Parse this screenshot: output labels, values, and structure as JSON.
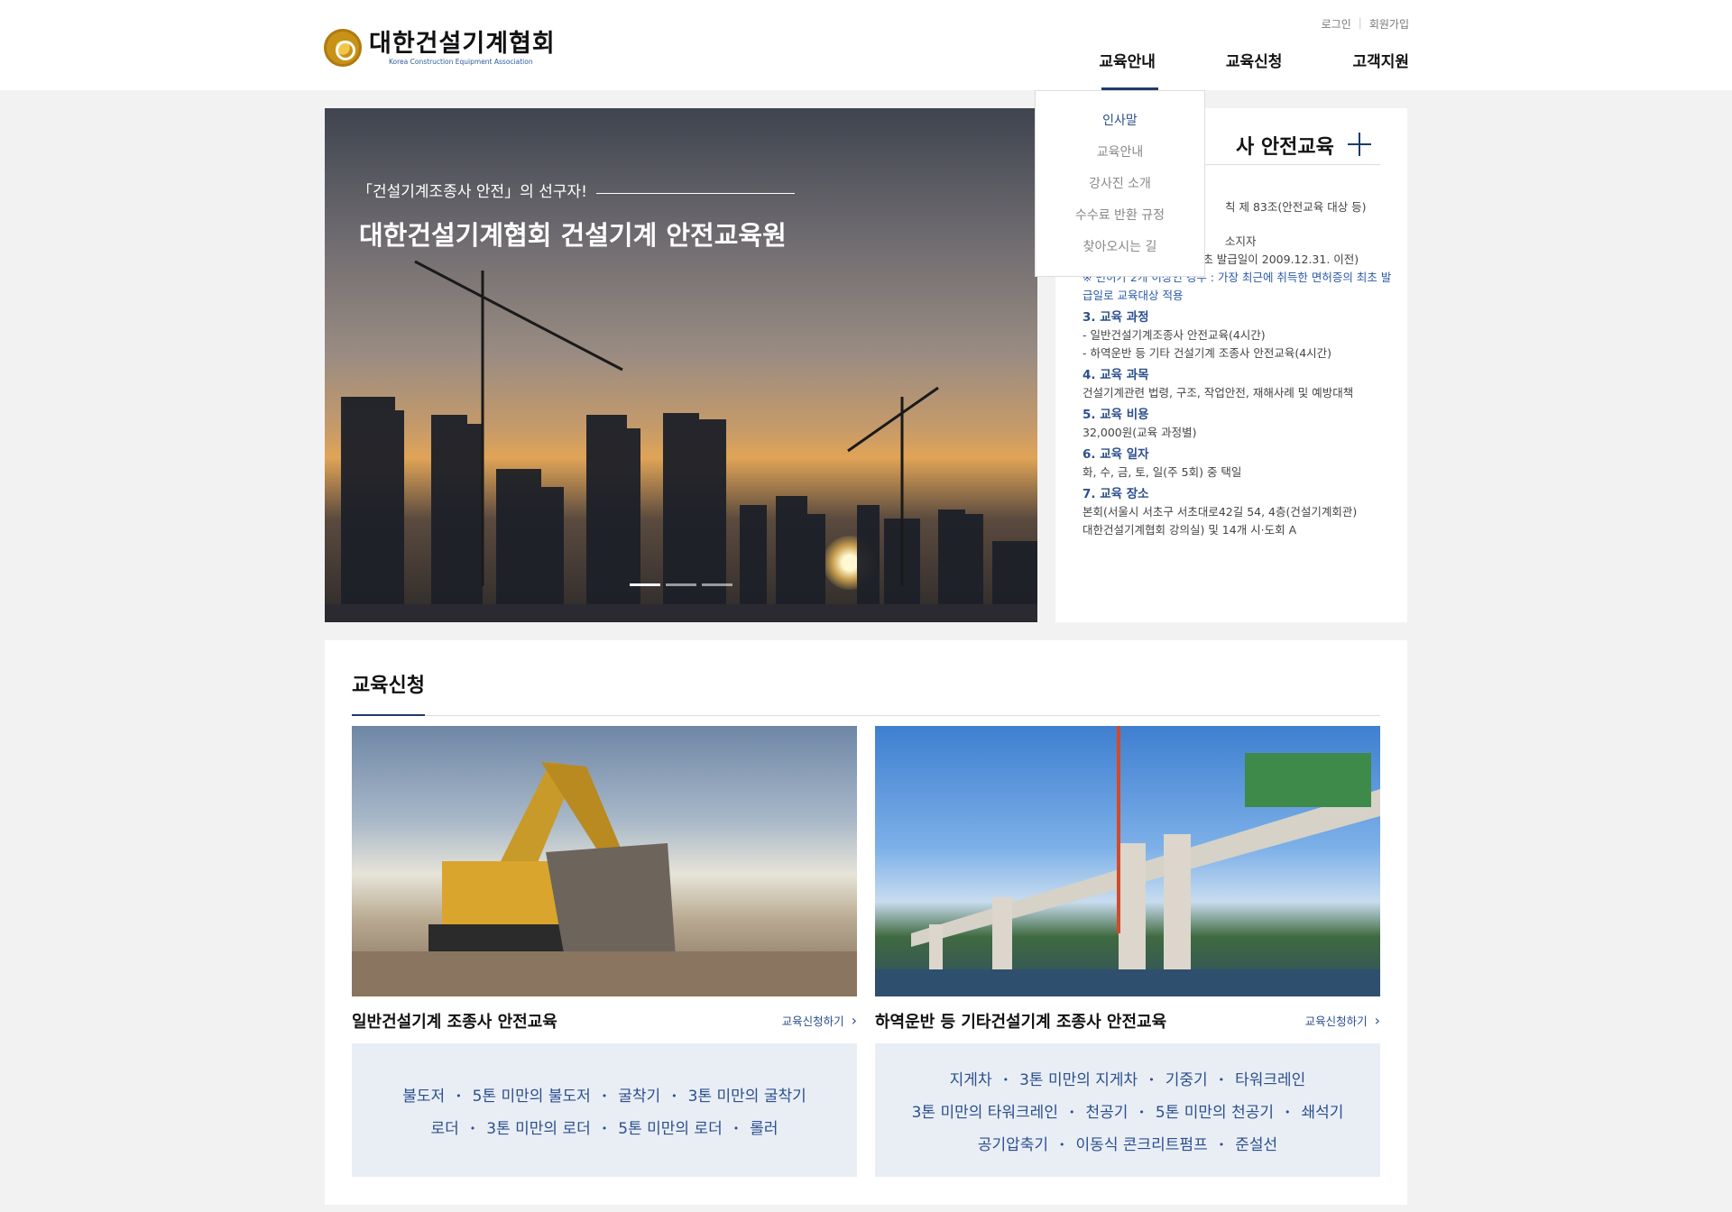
{
  "header": {
    "logo_ko": "대한건설기계협회",
    "logo_en": "Korea Construction Equipment Association",
    "util": {
      "login": "로그인",
      "join": "회원가입"
    },
    "nav": [
      "교육안내",
      "교육신청",
      "고객지원"
    ],
    "dropdown": [
      "인사말",
      "교육안내",
      "강사진 소개",
      "수수료 반환 규정",
      "찾아오시는 길"
    ]
  },
  "hero": {
    "subtitle": "「건설기계조종사 안전」의 선구자!",
    "title": "대한건설기계협회 건설기계 안전교육원",
    "slides": 3,
    "active_slide": 1
  },
  "info": {
    "title_visible": "사 안전교육",
    "line1": "칙 제 83조(안전교육 대상 등)",
    "line2": "소지자",
    "line3": "(2020년도 대상: 면허 최초 발급일이 2009.12.31. 이전)",
    "note": "※ 면허가 2개 이상인 경우 : 가장 최근에 취득한 면허증의 최초 발급일로 교육대상 적용",
    "s3_h": "3. 교육 과정",
    "s3_1": "- 일반건설기계조종사 안전교육(4시간)",
    "s3_2": "- 하역운반 등 기타 건설기계 조종사 안전교육(4시간)",
    "s4_h": "4. 교육 과목",
    "s4_1": "건설기계관련 법령, 구조, 작업안전, 재해사례 및 예방대책",
    "s5_h": "5. 교육 비용",
    "s5_1": "32,000원(교육 과정별)",
    "s6_h": "6. 교육 일자",
    "s6_1": "화, 수, 금, 토, 일(주 5회) 중 택일",
    "s7_h": "7. 교육 장소",
    "s7_1": "본회(서울시 서초구 서초대로42길 54, 4층(건설기계회관)",
    "s7_2": "대한건설기계협회 강의실) 및 14개 시·도회 A"
  },
  "edu": {
    "heading": "교육신청",
    "cards": [
      {
        "title": "일반건설기계 조종사 안전교육",
        "link": "교육신청하기",
        "rows": [
          [
            "불도저",
            "5톤 미만의 불도저",
            "굴착기",
            "3톤 미만의 굴착기"
          ],
          [
            "로더",
            "3톤 미만의 로더",
            "5톤 미만의 로더",
            "롤러"
          ]
        ]
      },
      {
        "title": "하역운반 등 기타건설기계 조종사 안전교육",
        "link": "교육신청하기",
        "rows": [
          [
            "지게차",
            "3톤 미만의 지게차",
            "기중기",
            "타워크레인"
          ],
          [
            "3톤 미만의 타워크레인",
            "천공기",
            "5톤 미만의 천공기",
            "쇄석기"
          ],
          [
            "공기압축기",
            "이동식 콘크리트펌프",
            "준설선"
          ]
        ]
      }
    ]
  }
}
